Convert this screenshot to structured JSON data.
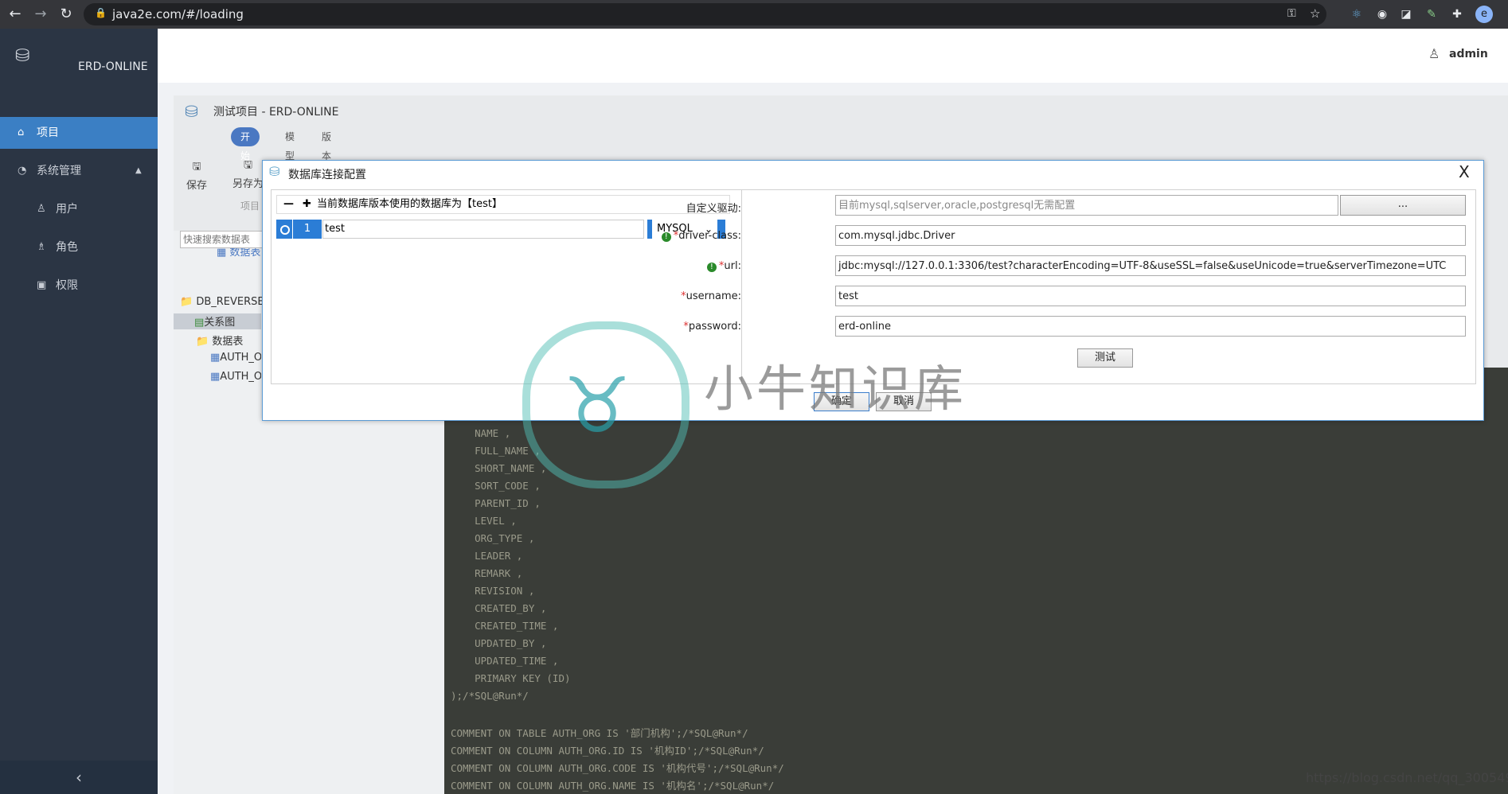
{
  "browser": {
    "url": "java2e.com/#/loading",
    "profile_initial": "e"
  },
  "sidebar": {
    "app_name": "ERD-ONLINE",
    "items": [
      {
        "label": "项目",
        "icon": "home-icon",
        "active": true
      },
      {
        "label": "系统管理",
        "icon": "dashboard-icon",
        "active": false
      }
    ],
    "sub_items": [
      {
        "label": "用户",
        "icon": "user-icon"
      },
      {
        "label": "角色",
        "icon": "team-icon"
      },
      {
        "label": "权限",
        "icon": "lock-icon"
      }
    ],
    "collapse_glyph": "‹"
  },
  "header": {
    "username": "admin"
  },
  "project": {
    "title": "测试项目 - ERD-ONLINE",
    "tabs": [
      "开始",
      "模型",
      "版本"
    ],
    "tools": [
      {
        "label": "保存"
      },
      {
        "label": "另存为"
      }
    ],
    "sub_label": "项目",
    "panel_tab": "数据表",
    "search_placeholder": "快速搜索数据表",
    "tree": [
      "DB_REVERSE_MYSQL",
      "关系图",
      "数据表",
      "AUTH_ORG",
      "AUTH_ORG"
    ]
  },
  "code_lines": [
    "    NAME ,",
    "    FULL_NAME ,",
    "    SHORT_NAME ,",
    "    SORT_CODE ,",
    "    PARENT_ID ,",
    "    LEVEL ,",
    "    ORG_TYPE ,",
    "    LEADER ,",
    "    REMARK ,",
    "    REVISION ,",
    "    CREATED_BY ,",
    "    CREATED_TIME ,",
    "    UPDATED_BY ,",
    "    UPDATED_TIME ,",
    "    PRIMARY KEY (ID)",
    ");/*SQL@Run*/",
    "",
    "COMMENT ON TABLE AUTH_ORG IS '部门机构';/*SQL@Run*/",
    "COMMENT ON COLUMN AUTH_ORG.ID IS '机构ID';/*SQL@Run*/",
    "COMMENT ON COLUMN AUTH_ORG.CODE IS '机构代号';/*SQL@Run*/",
    "COMMENT ON COLUMN AUTH_ORG.NAME IS '机构名';/*SQL@Run*/"
  ],
  "modal": {
    "title": "数据库连接配置",
    "close": "X",
    "list_header": "当前数据库版本使用的数据库为【test】",
    "row": {
      "index": "1",
      "name": "test",
      "db_type": "MYSQL"
    },
    "fields": {
      "custom_driver_label": "自定义驱动:",
      "custom_driver_placeholder": "目前mysql,sqlserver,oracle,postgresql无需配置",
      "browse_button": "...",
      "driver_class_label": "driver-class:",
      "driver_class_value": "com.mysql.jdbc.Driver",
      "url_label": "url:",
      "url_value": "jdbc:mysql://127.0.0.1:3306/test?characterEncoding=UTF-8&useSSL=false&useUnicode=true&serverTimezone=UTC",
      "username_label": "username:",
      "username_value": "test",
      "password_label": "password:",
      "password_value": "erd-online"
    },
    "test_button": "测试",
    "ok_button": "确定",
    "cancel_button": "取消"
  },
  "watermarks": {
    "brand": "小牛知识库",
    "url": "https://blog.csdn.net/qq_30054961"
  },
  "colors": {
    "sidebar_bg": "#2b3544",
    "accent": "#3b7fc4",
    "row_selected": "#2b7dd6",
    "code_bg": "#3a3d38"
  }
}
